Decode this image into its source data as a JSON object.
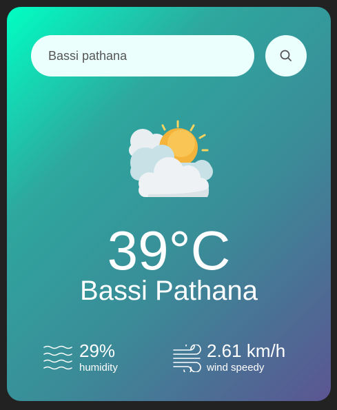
{
  "search": {
    "value": "Bassi pathana",
    "placeholder": "",
    "button_icon": "search-icon"
  },
  "weather": {
    "icon": "sun-behind-clouds-icon",
    "temperature": "39°C",
    "city": "Bassi Pathana"
  },
  "details": {
    "humidity": {
      "icon": "waves-icon",
      "value": "29%",
      "label": "humidity"
    },
    "wind": {
      "icon": "wind-icon",
      "value": "2.61 km/h",
      "label": "wind speedy"
    }
  },
  "colors": {
    "gradient_start": "#00ffc3",
    "gradient_end": "#5b5592",
    "input_background": "#ebfffc",
    "text": "#ffffff",
    "page_background": "#222222"
  }
}
